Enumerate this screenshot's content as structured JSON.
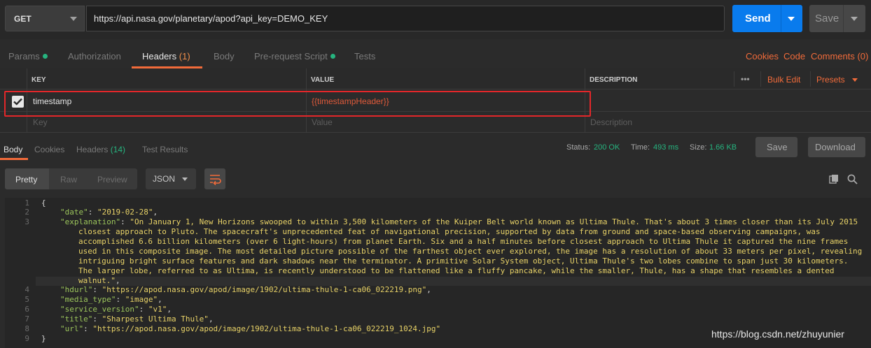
{
  "request": {
    "method": "GET",
    "url": "https://api.nasa.gov/planetary/apod?api_key=DEMO_KEY",
    "send_label": "Send",
    "save_label": "Save"
  },
  "request_tabs": [
    {
      "label": "Params",
      "dot": true
    },
    {
      "label": "Authorization"
    },
    {
      "label": "Headers",
      "count": "(1)",
      "active": true
    },
    {
      "label": "Body"
    },
    {
      "label": "Pre-request Script",
      "dot": true
    },
    {
      "label": "Tests"
    }
  ],
  "request_links": {
    "cookies": "Cookies",
    "code": "Code",
    "comments": "Comments (0)"
  },
  "headers_table": {
    "columns": {
      "key": "KEY",
      "value": "VALUE",
      "description": "DESCRIPTION"
    },
    "more": "•••",
    "bulk_edit": "Bulk Edit",
    "presets": "Presets",
    "rows": [
      {
        "key": "timestamp",
        "value": "{{timestampHeader}}",
        "checked": true
      }
    ],
    "placeholders": {
      "key": "Key",
      "value": "Value",
      "description": "Description"
    }
  },
  "response_tabs": [
    {
      "label": "Body",
      "active": true
    },
    {
      "label": "Cookies"
    },
    {
      "label": "Headers",
      "count": "(14)"
    },
    {
      "label": "Test Results"
    }
  ],
  "response_status": {
    "status_label": "Status:",
    "status_value": "200 OK",
    "time_label": "Time:",
    "time_value": "493 ms",
    "size_label": "Size:",
    "size_value": "1.66 KB",
    "save_label": "Save",
    "download_label": "Download"
  },
  "format_bar": {
    "pretty": "Pretty",
    "raw": "Raw",
    "preview": "Preview",
    "format": "JSON"
  },
  "code_lines": {
    "l1": "{",
    "l2_key": "\"date\"",
    "l2_val": "\"2019-02-28\"",
    "l3_key": "\"explanation\"",
    "l3_a": "\"On January 1, New Horizons swooped to within 3,500 kilometers of the Kuiper Belt world known as Ultima Thule. That's about 3 times closer than its July 2015",
    "l3_b": "closest approach to Pluto. The spacecraft's unprecedented feat of navigational precision, supported by data from ground and space-based observing campaigns, was",
    "l3_c": "accomplished 6.6 billion kilometers (over 6 light-hours) from planet Earth. Six and a half minutes before closest approach to Ultima Thule it captured the nine frames",
    "l3_d": "used in this composite image. The most detailed picture possible of the farthest object ever explored, the image has a resolution of about 33 meters per pixel, revealing",
    "l3_e": "intriguing bright surface features and dark shadows near the terminator. A primitive Solar System object, Ultima Thule's two lobes combine to span just 30 kilometers.",
    "l3_f": "The larger lobe, referred to as Ultima, is recently understood to be flattened like a fluffy pancake, while the smaller, Thule, has a shape that resembles a dented",
    "l3_g": "walnut.\"",
    "l4_key": "\"hdurl\"",
    "l4_val": "\"https://apod.nasa.gov/apod/image/1902/ultima-thule-1-ca06_022219.png\"",
    "l5_key": "\"media_type\"",
    "l5_val": "\"image\"",
    "l6_key": "\"service_version\"",
    "l6_val": "\"v1\"",
    "l7_key": "\"title\"",
    "l7_val": "\"Sharpest Ultima Thule\"",
    "l8_key": "\"url\"",
    "l8_val": "\"https://apod.nasa.gov/apod/image/1902/ultima-thule-1-ca06_022219_1024.jpg\"",
    "l9": "}"
  },
  "line_numbers": [
    "1",
    "2",
    "3",
    "4",
    "5",
    "6",
    "7",
    "8",
    "9"
  ],
  "watermark": "https://blog.csdn.net/zhuyunier"
}
